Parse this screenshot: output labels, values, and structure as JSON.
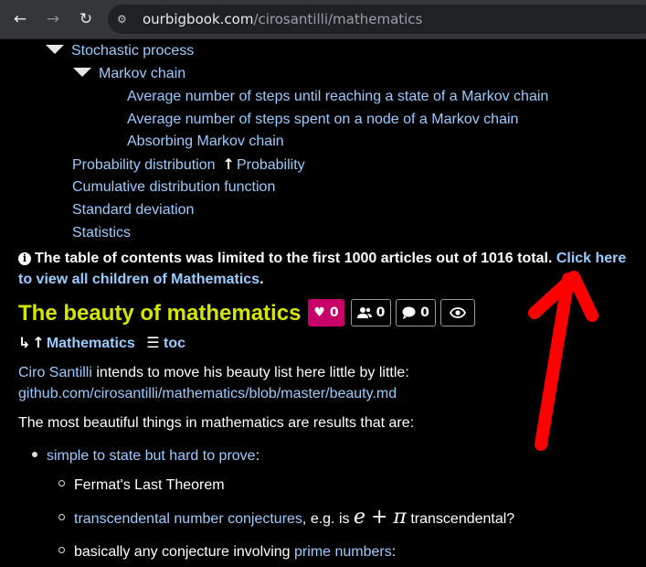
{
  "browser": {
    "url_host": "ourbigbook.com",
    "url_path": "/cirosantilli/mathematics"
  },
  "toc": {
    "items": [
      {
        "label": "Stochastic process"
      },
      {
        "label": "Markov chain"
      },
      {
        "label": "Average number of steps until reaching a state of a Markov chain"
      },
      {
        "label": "Average number of steps spent on a node of a Markov chain"
      },
      {
        "label": "Absorbing Markov chain"
      },
      {
        "label": "Probability distribution",
        "parent": "Probability"
      },
      {
        "label": "Cumulative distribution function"
      },
      {
        "label": "Standard deviation"
      },
      {
        "label": "Statistics"
      }
    ]
  },
  "notice": {
    "text": "The table of contents was limited to the first 1000 articles out of 1016 total.",
    "link": "Click here to view all children of Mathematics",
    "end": "."
  },
  "article": {
    "title": "The beauty of mathematics",
    "stats": {
      "likes": "0",
      "followers": "0",
      "comments": "0"
    },
    "breadcrumb_parent": "Mathematics",
    "breadcrumb_toc": "toc",
    "author_link": "Ciro Santilli",
    "intro_text": "intends to move his beauty list here little by little:",
    "github_link": "github.com/cirosantilli/mathematics/blob/master/beauty.md",
    "para2": "The most beautiful things in mathematics are results that are:",
    "b1_link": "simple to state but hard to prove",
    "b1_end": ":",
    "s1": "Fermat's Last Theorem",
    "s2_link": "transcendental number conjectures",
    "s2_mid": ", e.g. is",
    "math_e": "e",
    "math_plus": "+",
    "math_pi": "π",
    "s2_end": "transcendental?",
    "s3_text": "basically any conjecture involving",
    "s3_link": "prime numbers",
    "s3_end": ":"
  }
}
